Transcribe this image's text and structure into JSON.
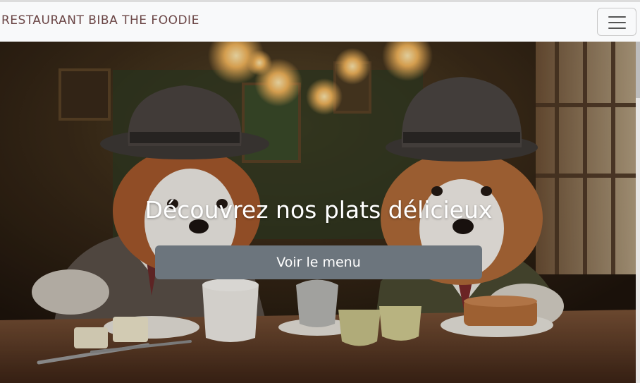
{
  "navbar": {
    "brand": "RESTAURANT BIBA THE FOODIE",
    "toggler_icon": "hamburger-menu-icon"
  },
  "hero": {
    "title": "Découvrez nos plats délicieux",
    "button_label": "Voir le menu",
    "image": "two-dogs-in-hats-at-cafe-table"
  },
  "colors": {
    "brand": "#6b4646",
    "button": "#6c757d",
    "navbar_bg": "#f8f9fa"
  }
}
